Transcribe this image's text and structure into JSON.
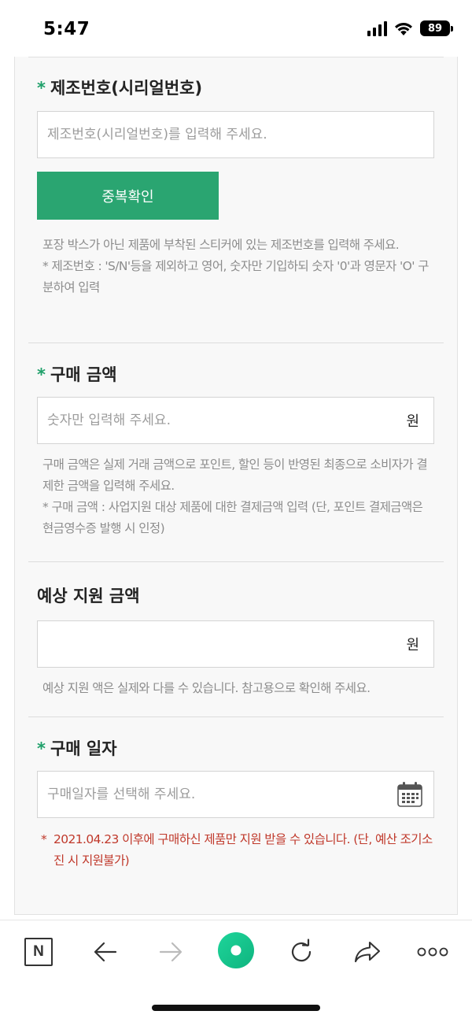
{
  "status_bar": {
    "time": "5:47",
    "battery": "89",
    "icons": [
      "signal-icon",
      "wifi-icon",
      "battery-icon"
    ]
  },
  "serial": {
    "required_mark": "*",
    "title": "제조번호(시리얼번호)",
    "placeholder": "제조번호(시리얼번호)를 입력해 주세요.",
    "button_label": "중복확인",
    "help_lines": [
      "포장 박스가 아닌 제품에 부착된 스티커에 있는 제조번호를 입력해 주세요.",
      "* 제조번호 : 'S/N'등을 제외하고 영어, 숫자만 기입하되 숫자 '0'과 영문자 'O' 구분하여 입력"
    ]
  },
  "amount": {
    "required_mark": "*",
    "title": "구매 금액",
    "placeholder": "숫자만 입력해 주세요.",
    "unit": "원",
    "help_lines": [
      "구매 금액은 실제 거래 금액으로 포인트, 할인 등이 반영된 최종으로 소비자가 결제한 금액을 입력해 주세요.",
      "* 구매 금액 : 사업지원 대상 제품에 대한 결제금액 입력 (단, 포인트 결제금액은 현금영수증 발행 시 인정)"
    ]
  },
  "estimated": {
    "title": "예상 지원 금액",
    "unit": "원",
    "help": "예상 지원 액은 실제와 다를 수 있습니다. 참고용으로 확인해 주세요."
  },
  "date": {
    "required_mark": "*",
    "title": "구매 일자",
    "placeholder": "구매일자를 선택해 주세요.",
    "warning_mark": "*",
    "warning": "2021.04.23 이후에 구매하신 제품만 지원 받을 수 있습니다. (단, 예산 조기소진 시 지원불가)"
  },
  "colors": {
    "accent": "#2aa571",
    "required": "#1fa06a",
    "warning": "#c0392b",
    "help_text": "#8c8c8c"
  },
  "toolbar": {
    "n_label": "N",
    "icons": [
      "naver-n-icon",
      "back-arrow-icon",
      "forward-arrow-icon",
      "green-dot-icon",
      "reload-icon",
      "share-icon",
      "more-icon"
    ]
  }
}
